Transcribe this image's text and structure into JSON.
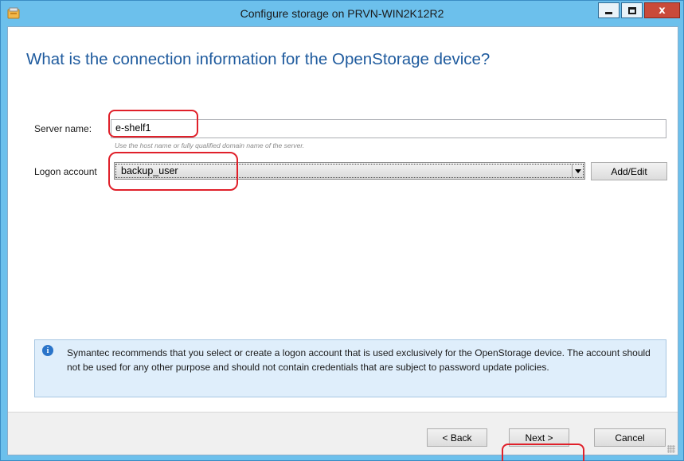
{
  "window": {
    "title": "Configure storage on PRVN-WIN2K12R2",
    "close_glyph": "x"
  },
  "page": {
    "heading": "What is the connection information for the OpenStorage device?"
  },
  "form": {
    "server_label": "Server name:",
    "server_value": "e-shelf1",
    "server_hint": "Use the host name or fully qualified domain name of the server.",
    "logon_label": "Logon account",
    "logon_value": "backup_user",
    "add_edit_label": "Add/Edit"
  },
  "info": {
    "icon": "info-icon",
    "text": "Symantec recommends that you select or create a logon account that is used exclusively for the OpenStorage device. The account should not be used for any other purpose and should not contain credentials that are subject to password update policies."
  },
  "footer": {
    "back_label": "< Back",
    "next_label": "Next >",
    "cancel_label": "Cancel"
  },
  "colors": {
    "title_bar": "#6cc0ec",
    "heading": "#1f5b9e",
    "annotation": "#e0202a",
    "info_background": "#dfeefb"
  }
}
